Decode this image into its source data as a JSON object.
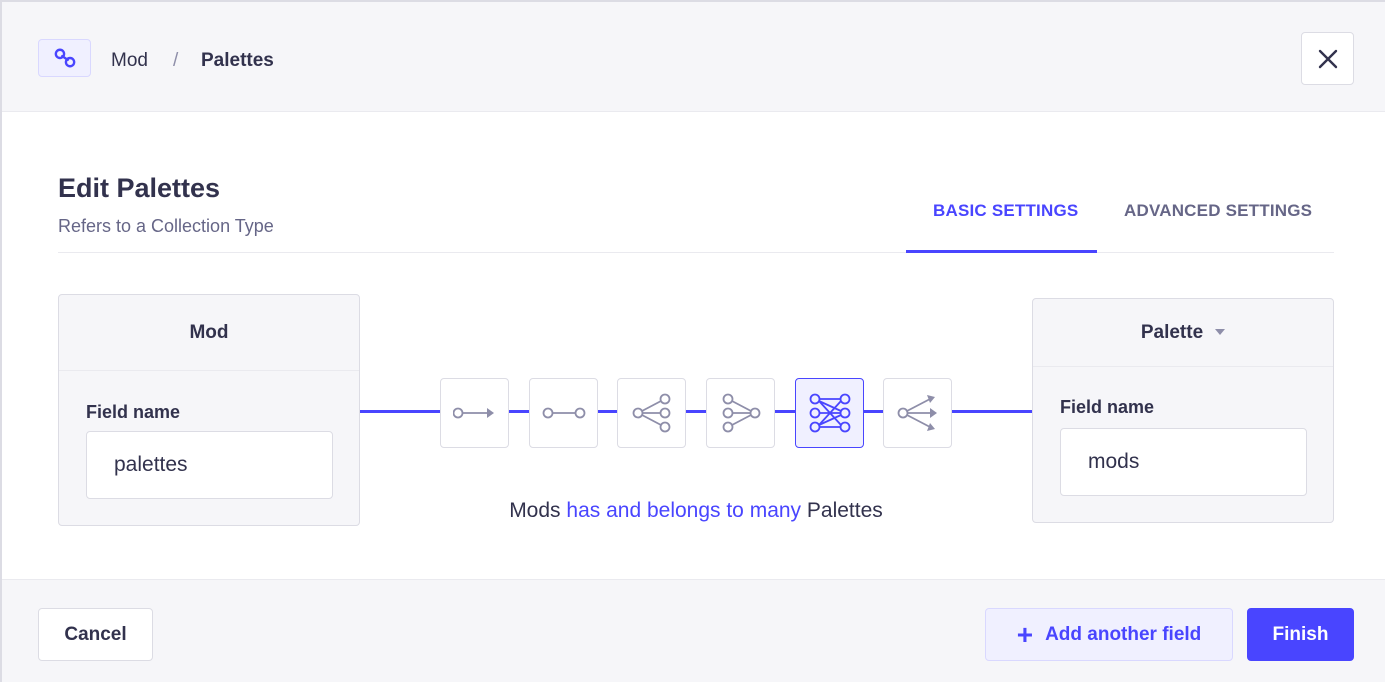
{
  "breadcrumb": {
    "icon": "link-icon",
    "parent": "Mod",
    "separator": "/",
    "current": "Palettes"
  },
  "header": {
    "title": "Edit Palettes",
    "subtitle": "Refers to a Collection Type"
  },
  "tabs": {
    "basic": "BASIC SETTINGS",
    "advanced": "ADVANCED SETTINGS",
    "active": "basic"
  },
  "relation": {
    "left": {
      "name": "Mod",
      "field_label": "Field name",
      "field_value": "palettes"
    },
    "right": {
      "name": "Palette",
      "field_label": "Field name",
      "field_value": "mods"
    },
    "types": [
      {
        "name": "one-way-icon",
        "active": false
      },
      {
        "name": "one-to-one-icon",
        "active": false
      },
      {
        "name": "one-to-many-icon",
        "active": false
      },
      {
        "name": "many-to-one-icon",
        "active": false
      },
      {
        "name": "many-to-many-icon",
        "active": true
      },
      {
        "name": "many-way-icon",
        "active": false
      }
    ],
    "description": {
      "start": "Mods",
      "middle": "has and belongs to many",
      "end": "Palettes"
    }
  },
  "footer": {
    "cancel": "Cancel",
    "add_field": "Add another field",
    "finish": "Finish"
  },
  "colors": {
    "primary": "#4945ff",
    "neutral_bg": "#f6f6f9",
    "border": "#dcdce4"
  }
}
